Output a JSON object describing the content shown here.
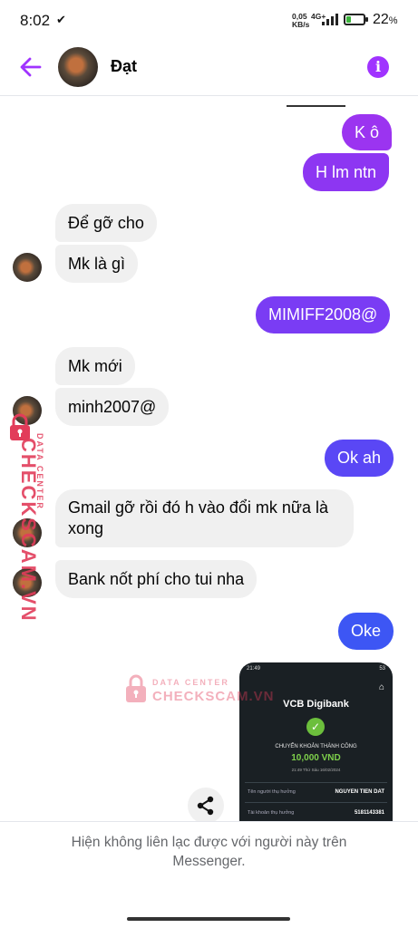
{
  "status_bar": {
    "time": "8:02",
    "speed_value": "0,05",
    "speed_unit": "KB/s",
    "network": "4G+",
    "battery_percent": "22",
    "battery_symbol": "%",
    "battery_level": 0.22
  },
  "header": {
    "contact_name": "Đạt",
    "back_icon": "arrow-left-icon",
    "info_icon": "info-icon",
    "accent_color": "#a033ff"
  },
  "messages": [
    {
      "direction": "out",
      "text": "K ô",
      "color": "#9b34f0"
    },
    {
      "direction": "out",
      "text": "H lm ntn",
      "color": "#8d36f2"
    },
    {
      "direction": "in",
      "text": "Để gỡ cho"
    },
    {
      "direction": "in",
      "text": "Mk là gì"
    },
    {
      "direction": "out",
      "text": "MIMIFF2008@",
      "color": "#7a3cf4"
    },
    {
      "direction": "in",
      "text": "Mk mới"
    },
    {
      "direction": "in",
      "text": "minh2007@"
    },
    {
      "direction": "out",
      "text": "Ok ah",
      "color": "#5a47f5"
    },
    {
      "direction": "in",
      "text": "Gmail gỡ rồi đó h vào đổi mk nữa là xong"
    },
    {
      "direction": "in",
      "text": "Bank nốt phí cho tui nha"
    },
    {
      "direction": "out",
      "text": "Oke",
      "color": "#3d56f4"
    }
  ],
  "watermark": {
    "brand": "CHECKSCAM.VN",
    "tagline": "DATA CENTER"
  },
  "receipt_image": {
    "time": "21:49",
    "battery": "53",
    "bank": "VCB Digibank",
    "status": "CHUYỂN KHOẢN THÀNH CÔNG",
    "amount": "10,000 VND",
    "datetime": "21:49 Thứ Sáu 16/02/2024",
    "recipient_label": "Tên người thụ hưởng",
    "recipient_value": "NGUYEN TIEN DAT",
    "account_label": "Tài khoản thụ hưởng",
    "account_value": "5181143381"
  },
  "share_icon": "share-icon",
  "footer": {
    "notice": "Hiện không liên lạc được với người này trên Messenger."
  }
}
